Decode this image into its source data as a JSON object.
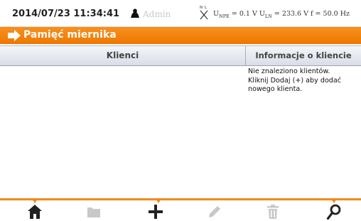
{
  "status": {
    "datetime": "2014/07/23 11:34:41",
    "user": "Admin",
    "plug_label": "N L",
    "upe_label": "U",
    "upe_sub": "NPE",
    "upe_value": "= 0.1 V",
    "uln_label": "U",
    "uln_sub": "LN",
    "uln_value": "= 233.6 V",
    "freq": "f = 50.0 Hz"
  },
  "title": "Pamięć miernika",
  "table": {
    "col_clients": "Klienci",
    "col_info": "Informacje o kliencie"
  },
  "info": {
    "line1": "Nie znaleziono klientów.",
    "line2": "Kliknij Dodaj (+) aby dodać",
    "line3": "nowego klienta."
  },
  "toolbar": {
    "items": [
      "home-icon",
      "folder-icon",
      "add-icon",
      "edit-icon",
      "delete-icon",
      "search-icon"
    ],
    "enabled": [
      true,
      false,
      true,
      false,
      false,
      true
    ]
  },
  "colors": {
    "accent": "#f08a1c",
    "disabled": "#c8c8c8",
    "icon": "#222222"
  }
}
